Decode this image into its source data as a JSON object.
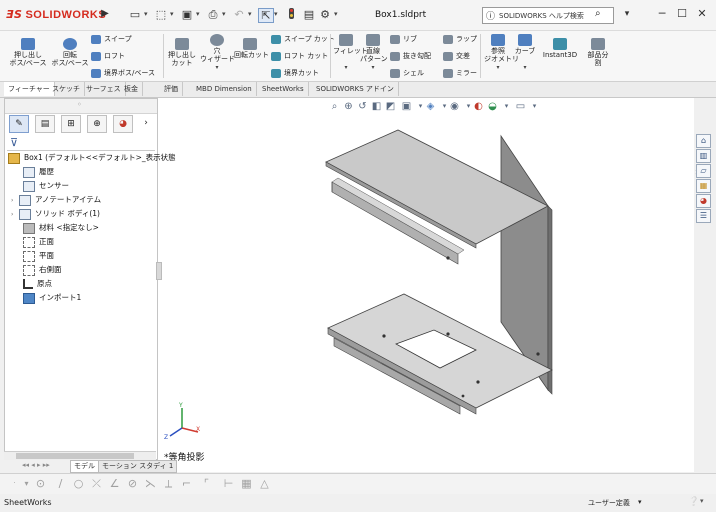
{
  "app": {
    "logo_text": "SOLIDWORKS",
    "document_title": "Box1.sldprt",
    "help_search_placeholder": "SOLIDWORKS ヘルプ検索"
  },
  "ribbon": {
    "buttons": [
      {
        "label1": "押し出し",
        "label2": "ボス/ベース"
      },
      {
        "label1": "回転",
        "label2": "ボス/ベース"
      },
      {
        "label1": "押し出し",
        "label2": "カット"
      },
      {
        "label1": "穴",
        "label2": "ウィザード"
      },
      {
        "label1": "回転カット",
        "label2": ""
      },
      {
        "label1": "フィレット",
        "label2": ""
      },
      {
        "label1": "直線",
        "label2": "パターン"
      },
      {
        "label1": "参照",
        "label2": "ジオメトリ"
      },
      {
        "label1": "カーブ",
        "label2": ""
      },
      {
        "label1": "Instant3D",
        "label2": ""
      },
      {
        "label1": "部品分",
        "label2": "割"
      }
    ],
    "small_buttons": [
      "スイープ",
      "ロフト",
      "境界ボス/ベース",
      "スイープ カット",
      "ロフト カット",
      "境界カット",
      "リブ",
      "抜き勾配",
      "シェル",
      "ラップ",
      "交差",
      "ミラー"
    ]
  },
  "tabs": [
    {
      "label": "フィーチャー",
      "active": true
    },
    {
      "label": "スケッチ",
      "active": false
    },
    {
      "label": "サーフェス",
      "active": false
    },
    {
      "label": "板金",
      "active": false
    },
    {
      "label": "評価",
      "active": false
    },
    {
      "label": "MBD Dimension",
      "active": false
    },
    {
      "label": "SheetWorks",
      "active": false
    },
    {
      "label": "SOLIDWORKS アドイン",
      "active": false
    }
  ],
  "feature_tree": {
    "root": "Box1 (デフォルト<<デフォルト>_表示状態",
    "items": [
      {
        "label": "履歴",
        "icon": "history-icon"
      },
      {
        "label": "センサー",
        "icon": "sensor-icon"
      },
      {
        "label": "アノテートアイテム",
        "icon": "annotation-icon"
      },
      {
        "label": "ソリッド ボディ(1)",
        "icon": "solid-body-icon"
      },
      {
        "label": "材料 <指定なし>",
        "icon": "material-icon"
      },
      {
        "label": "正面",
        "icon": "plane-icon"
      },
      {
        "label": "平面",
        "icon": "plane-icon"
      },
      {
        "label": "右側面",
        "icon": "plane-icon"
      },
      {
        "label": "原点",
        "icon": "origin-icon"
      },
      {
        "label": "インポート1",
        "icon": "import-icon"
      }
    ]
  },
  "bottom_tabs": [
    {
      "label": "モデル",
      "active": true
    },
    {
      "label": "モーション スタディ 1",
      "active": false
    }
  ],
  "viewport": {
    "view_label": "*等角投影",
    "triad": {
      "x": "X",
      "y": "Y",
      "z": "Z"
    }
  },
  "status": {
    "left_text": "SheetWorks",
    "units": "ユーザー定義"
  },
  "colors": {
    "logo_red": "#d52b1e",
    "accent_blue": "#3d5f9a"
  }
}
